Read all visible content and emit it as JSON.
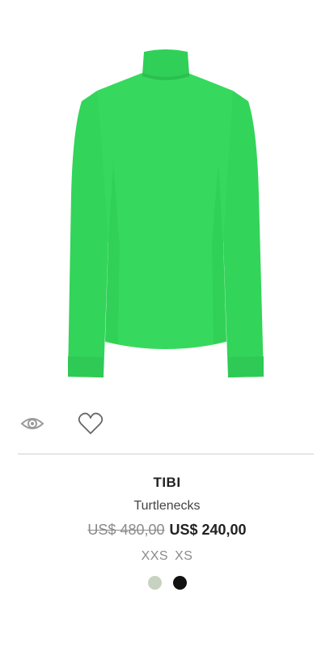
{
  "product": {
    "image_icon": "green-turtleneck-sweater",
    "garment_color": "#33d45a",
    "brand": "TIBI",
    "category": "Turtlenecks",
    "price_original": "US$ 480,00",
    "price_sale": "US$ 240,00",
    "sizes": [
      "XXS",
      "XS"
    ],
    "swatches": [
      {
        "color": "#c7d3c0",
        "selected": false
      },
      {
        "color": "#111111",
        "selected": false
      }
    ]
  },
  "actions": {
    "quick_view_icon": "eye-icon",
    "wishlist_icon": "heart-icon"
  }
}
